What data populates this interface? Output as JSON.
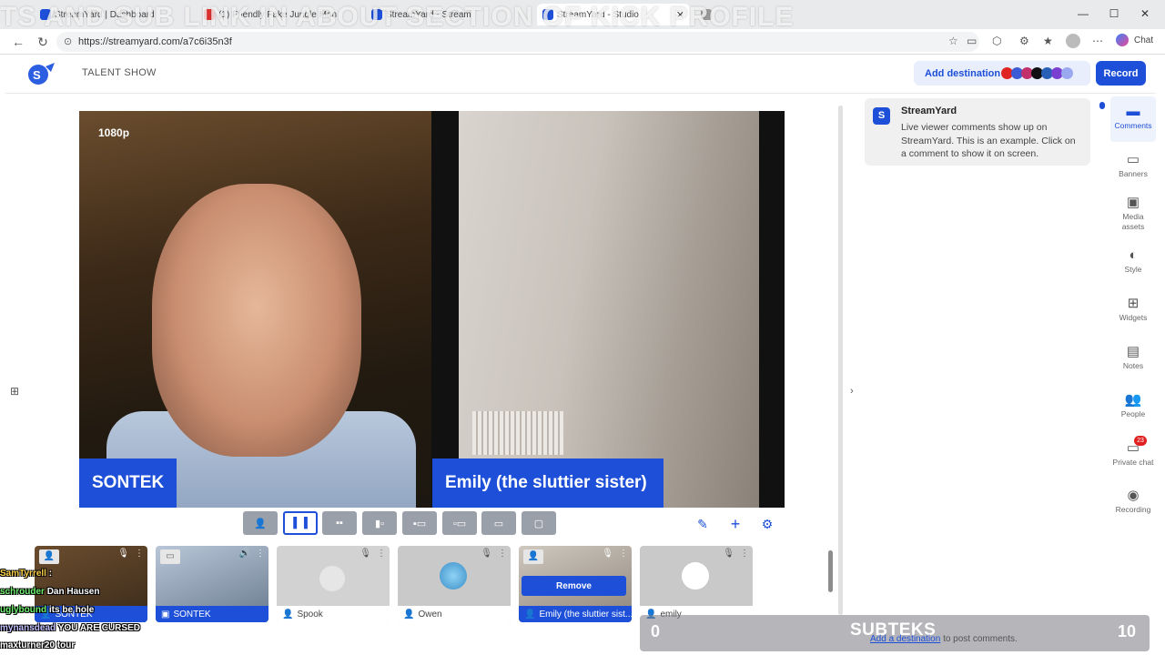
{
  "browser": {
    "tabs": [
      {
        "title": "StreamYard | Dashboard",
        "color": "#1d4fd8"
      },
      {
        "title": "(1) Friendly Fake Jungle Man",
        "color": "#e03030"
      },
      {
        "title": "StreamYard - Stream",
        "color": "#1d4fd8"
      },
      {
        "title": "StreamYard - Studio",
        "color": "#1d4fd8"
      },
      {
        "title": "",
        "color": "#999"
      }
    ],
    "url": "https://streamyard.com/a7c6i35n3f",
    "overlay_text": "TS AND SUB LINK IN ABOUT SECTION OF KICK PROFILE",
    "chat_label": "Chat"
  },
  "header": {
    "broadcast_title": "TALENT SHOW",
    "add_destination_label": "Add destination",
    "destination_colors": [
      "#e02424",
      "#3b5bd6",
      "#c2306b",
      "#111111",
      "#2860b8",
      "#7a3fd1",
      "#9aa8f0"
    ],
    "record_label": "Record"
  },
  "stage": {
    "resolution": "1080p",
    "left_name": "SONTEK",
    "right_name": "Emily (the sluttier sister)"
  },
  "participants": [
    {
      "name": "SONTEK",
      "on_stage": true
    },
    {
      "name": "SONTEK",
      "on_stage": true
    },
    {
      "name": "Spook",
      "on_stage": false
    },
    {
      "name": "Owen",
      "on_stage": false
    },
    {
      "name": "Emily (the sluttier sist...",
      "on_stage": true
    },
    {
      "name": "emily",
      "on_stage": false
    }
  ],
  "remove_label": "Remove",
  "chat_overlay": [
    {
      "user": "SamTyrrell",
      "msg": ":",
      "color": "#ffd24a"
    },
    {
      "user": "schrouder",
      "msg": "Dan Hausen",
      "color": "#6ef06e"
    },
    {
      "user": "uglybound",
      "msg": "its be hole",
      "color": "#6ef06e"
    },
    {
      "user": "mynansdead",
      "msg": "YOU ARE CURSED",
      "color": "#c0c0ff"
    },
    {
      "user": "maxturner20",
      "msg": "tour",
      "color": "#ffffff"
    }
  ],
  "comments": {
    "author": "StreamYard",
    "text": "Live viewer comments show up on StreamYard. This is an example. Click on a comment to show it on screen."
  },
  "sidebar": [
    {
      "label": "Comments",
      "icon": "comment-icon",
      "active": true
    },
    {
      "label": "Banners",
      "icon": "banner-icon",
      "active": false
    },
    {
      "label": "Media assets",
      "icon": "media-icon",
      "active": false
    },
    {
      "label": "Style",
      "icon": "palette-icon",
      "active": false
    },
    {
      "label": "Widgets",
      "icon": "widgets-icon",
      "active": false
    },
    {
      "label": "Notes",
      "icon": "notes-icon",
      "active": false
    },
    {
      "label": "People",
      "icon": "people-icon",
      "active": false
    },
    {
      "label": "Private chat",
      "icon": "private-chat-icon",
      "active": false
    },
    {
      "label": "Recording",
      "icon": "recording-icon",
      "active": false
    }
  ],
  "private_chat_badge": "23",
  "bottom_overlay": {
    "left_count": "0",
    "center_text": "SUBTEKS",
    "right_count": "10",
    "link_text": "Add a destination",
    "post_text": "to post comments."
  }
}
